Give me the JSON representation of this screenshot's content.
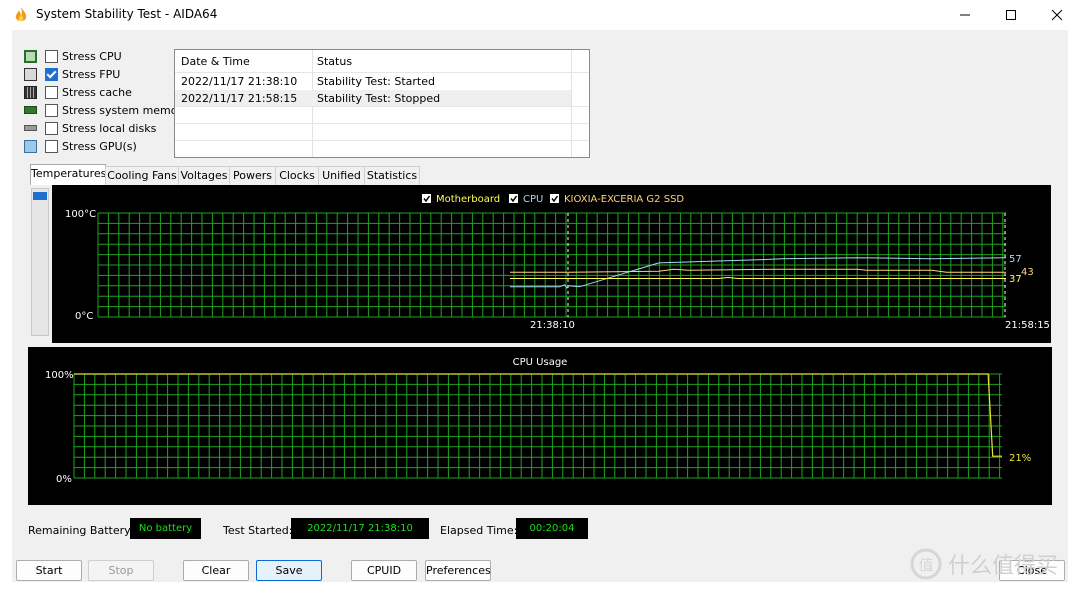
{
  "window": {
    "title": "System Stability Test - AIDA64"
  },
  "stress": [
    {
      "label": "Stress CPU",
      "checked": false,
      "icon": "cpu-icon"
    },
    {
      "label": "Stress FPU",
      "checked": true,
      "icon": "fpu-icon"
    },
    {
      "label": "Stress cache",
      "checked": false,
      "icon": "cache-icon"
    },
    {
      "label": "Stress system memory",
      "checked": false,
      "icon": "memory-icon"
    },
    {
      "label": "Stress local disks",
      "checked": false,
      "icon": "disk-icon"
    },
    {
      "label": "Stress GPU(s)",
      "checked": false,
      "icon": "gpu-icon"
    }
  ],
  "log": {
    "headers": [
      "Date & Time",
      "Status"
    ],
    "rows": [
      [
        "2022/11/17 21:38:10",
        "Stability Test: Started"
      ],
      [
        "2022/11/17 21:58:15",
        "Stability Test: Stopped"
      ]
    ]
  },
  "tabs": [
    "Temperatures",
    "Cooling Fans",
    "Voltages",
    "Powers",
    "Clocks",
    "Unified",
    "Statistics"
  ],
  "active_tab": "Temperatures",
  "chart_data": [
    {
      "type": "line",
      "title": "",
      "legend": [
        {
          "name": "Motherboard",
          "color": "#ffff55",
          "checked": true
        },
        {
          "name": "CPU",
          "color": "#a8d8f0",
          "checked": true
        },
        {
          "name": "KIOXIA-EXCERIA G2 SSD",
          "color": "#ffd27a",
          "checked": true
        }
      ],
      "y_top_label": "100°C",
      "y_bottom_label": "0°C",
      "ylim": [
        0,
        100
      ],
      "x_labels": [
        "21:38:10",
        "21:58:15"
      ],
      "end_labels": [
        "57",
        "43",
        "37"
      ],
      "series": [
        {
          "name": "CPU",
          "color": "#a8d8f0",
          "x": [
            0.0,
            0.1,
            0.11,
            0.115,
            0.118,
            0.14,
            0.3,
            0.5,
            0.55,
            0.7,
            0.85,
            1.0
          ],
          "y": [
            29,
            29,
            31,
            28,
            30,
            29,
            52,
            55,
            56,
            57,
            56,
            57
          ]
        },
        {
          "name": "KIOXIA-EXCERIA G2 SSD",
          "color": "#ffd27a",
          "x": [
            0.0,
            0.11,
            0.12,
            0.3,
            0.33,
            0.36,
            0.55,
            0.7,
            0.72,
            0.85,
            0.88,
            1.0
          ],
          "y": [
            43,
            43,
            43,
            44,
            46,
            45,
            46,
            46,
            45,
            45,
            43,
            43
          ]
        },
        {
          "name": "Motherboard",
          "color": "#ffff55",
          "x": [
            0.0,
            0.11,
            0.3,
            0.42,
            0.44,
            0.46,
            0.75,
            1.0
          ],
          "y": [
            37,
            37,
            37,
            37,
            38,
            37,
            37,
            37
          ]
        }
      ]
    },
    {
      "type": "line",
      "title": "CPU Usage",
      "y_top_label": "100%",
      "y_bottom_label": "0%",
      "ylim": [
        0,
        100
      ],
      "end_label": "21%",
      "series": [
        {
          "name": "CPU Usage",
          "color": "#e6e62a",
          "x": [
            0.0,
            0.985,
            0.99,
            1.0
          ],
          "y": [
            100,
            100,
            21,
            21
          ]
        }
      ]
    }
  ],
  "status": {
    "battery_label": "Remaining Battery:",
    "battery_value": "No battery",
    "started_label": "Test Started:",
    "started_value": "2022/11/17 21:38:10",
    "elapsed_label": "Elapsed Time:",
    "elapsed_value": "00:20:04"
  },
  "buttons": {
    "start": "Start",
    "stop": "Stop",
    "clear": "Clear",
    "save": "Save",
    "cpuid": "CPUID",
    "preferences": "Preferences",
    "close": "Close"
  },
  "watermark": "什么值得买",
  "colors": {
    "grid": "#1ea51e",
    "accent": "#1f6fd1",
    "status_text": "#19e019"
  }
}
